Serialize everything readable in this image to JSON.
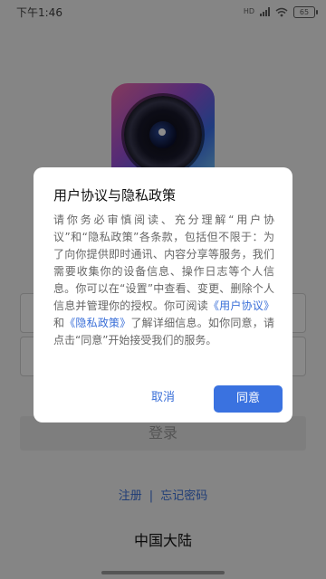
{
  "status_bar": {
    "time": "下午1:46",
    "signal_text": "HD",
    "battery": "65"
  },
  "login_page": {
    "login_button": "登录",
    "register_link": "注册",
    "separator": "|",
    "forgot_password_link": "忘记密码",
    "region": "中国大陆"
  },
  "dialog": {
    "title": "用户协议与隐私政策",
    "body_part1": "请你务必审慎阅读、充分理解“用户协议”和“隐私政策”各条款，包括但不限于：为了向你提供即时通讯、内容分享等服务，我们需要收集你的设备信息、操作日志等个人信息。你可以在“设置”中查看、变更、删除个人信息并管理你的授权。你可阅读",
    "link_user_agreement": "《用户协议》",
    "conj": "和",
    "link_privacy_policy": "《隐私政策》",
    "body_part2": "了解详细信息。如你同意，请点击“同意”开始接受我们的服务。",
    "cancel_label": "取消",
    "agree_label": "同意"
  },
  "colors": {
    "accent": "#3a72e0",
    "link": "#3a6fd8"
  }
}
